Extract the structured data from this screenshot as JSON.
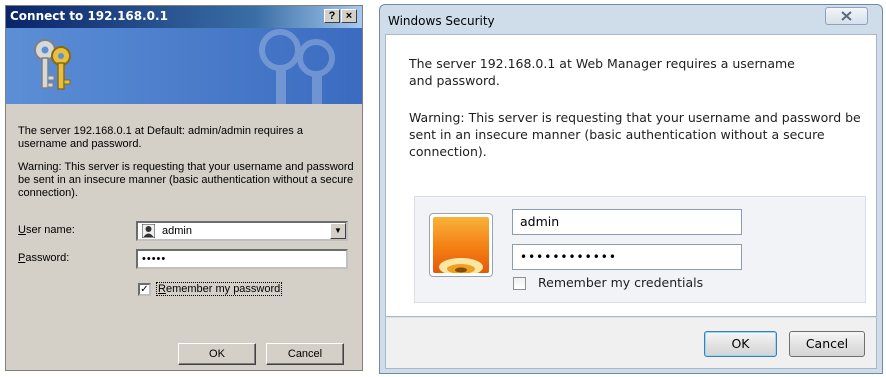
{
  "xp_dialog": {
    "title": "Connect to 192.168.0.1",
    "help_btn": "?",
    "close_btn": "×",
    "message": "The server 192.168.0.1 at Default: admin/admin requires a username and password.",
    "warning": "Warning: This server is requesting that your username and password be sent in an insecure manner (basic authentication without a secure connection).",
    "username_label_first": "U",
    "username_label_rest": "ser name:",
    "username_value": "admin",
    "password_label_first": "P",
    "password_label_rest": "assword:",
    "password_value": "•••••",
    "remember_checked": true,
    "remember_label_first": "R",
    "remember_label_rest": "emember my password",
    "ok_label": "OK",
    "cancel_label": "Cancel"
  },
  "win7_dialog": {
    "title": "Windows Security",
    "message": "The server 192.168.0.1 at Web Manager requires a username and password.",
    "warning": "Warning: This server is requesting that your username and password be sent in an insecure manner (basic authentication without a secure connection).",
    "username_value": "admin",
    "password_value": "••••••••••••",
    "remember_label": "Remember my credentials",
    "remember_checked": false,
    "ok_label": "OK",
    "cancel_label": "Cancel"
  },
  "colors": {
    "xp_title_start": "#0a246a",
    "xp_face": "#d4d0c8",
    "win7_frame": "#cfdcea",
    "win7_ok_border": "#3c7fb1"
  },
  "icons": [
    "keys-icon",
    "user-icon",
    "help-icon",
    "close-icon",
    "dropdown-arrow-icon",
    "user-tile-icon"
  ]
}
